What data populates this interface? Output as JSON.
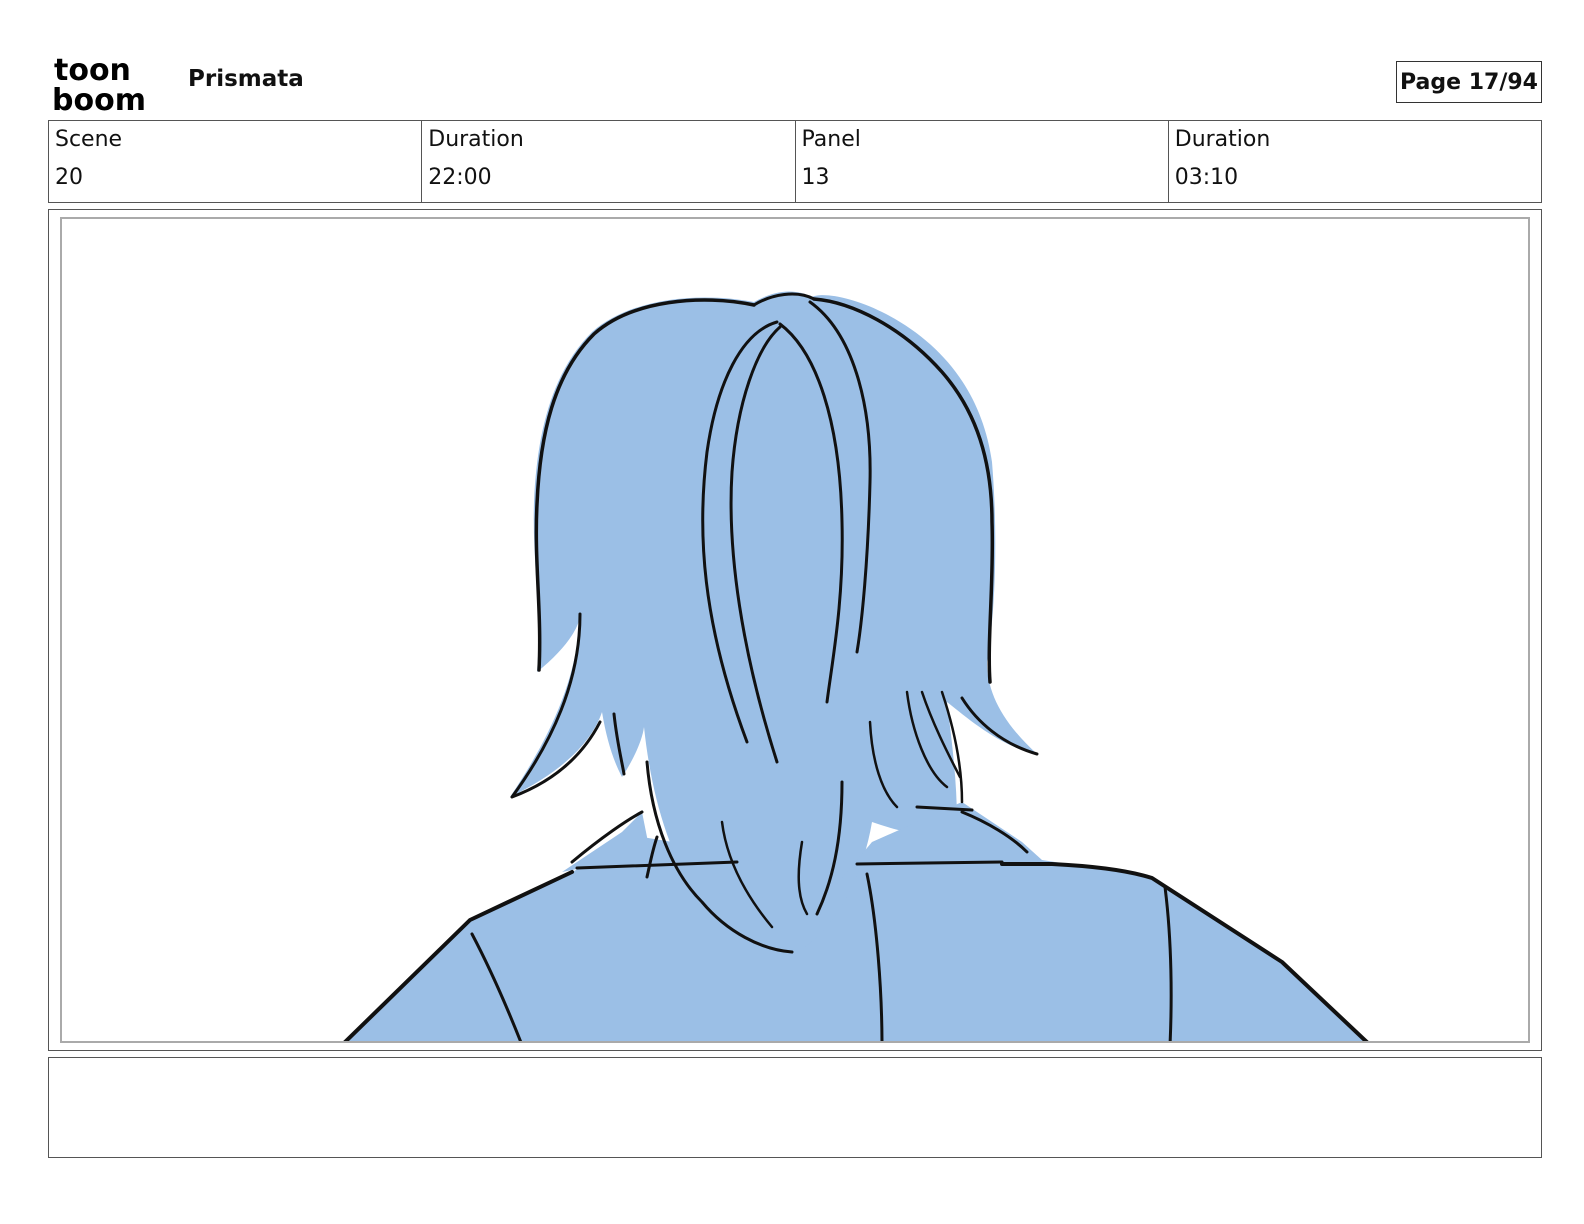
{
  "header": {
    "logo_line1": "toon",
    "logo_line2": "boom",
    "project_title": "Prismata",
    "page_counter": "Page 17/94"
  },
  "info": {
    "scene_label": "Scene",
    "scene_value": "20",
    "scene_duration_label": "Duration",
    "scene_duration_value": "22:00",
    "panel_label": "Panel",
    "panel_value": "13",
    "panel_duration_label": "Duration",
    "panel_duration_value": "03:10"
  },
  "drawing": {
    "fill_color": "#9bbfe6",
    "line_color": "#111111",
    "subject": "character-back-view"
  },
  "notes": {
    "text": ""
  }
}
